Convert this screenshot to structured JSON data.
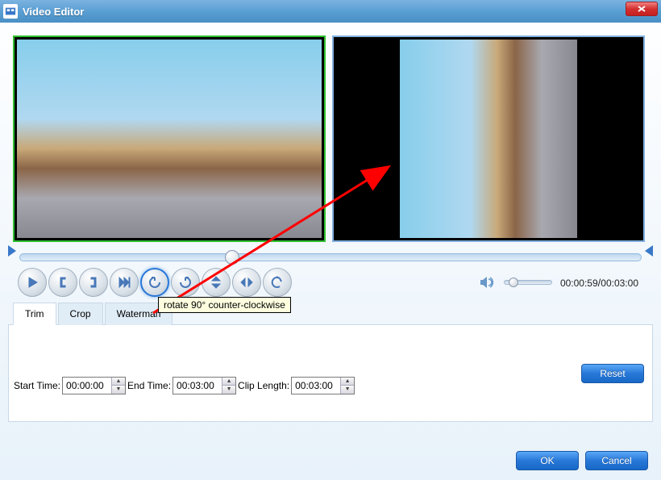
{
  "window": {
    "title": "Video Editor"
  },
  "tooltip": "rotate 90° counter-clockwise",
  "tabs": {
    "trim": "Trim",
    "crop": "Crop",
    "watermark": "Waterman"
  },
  "trim": {
    "start_label": "Start Time:",
    "start_value": "00:00:00",
    "end_label": "End Time:",
    "end_value": "00:03:00",
    "clip_label": "Clip Length:",
    "clip_value": "00:03:00"
  },
  "playback": {
    "current": "00:00:59",
    "total": "00:03:00"
  },
  "buttons": {
    "reset": "Reset",
    "ok": "OK",
    "cancel": "Cancel"
  }
}
